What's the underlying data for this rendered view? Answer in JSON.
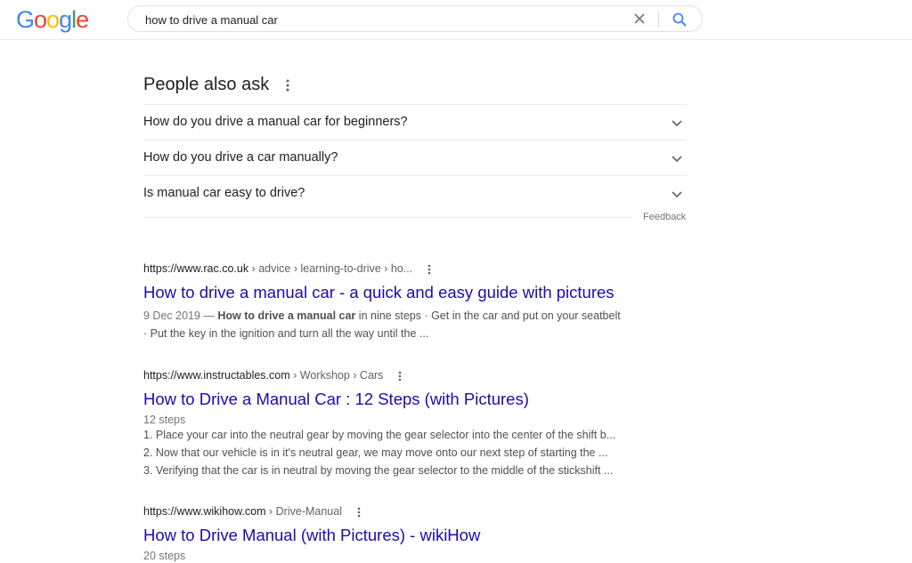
{
  "logo": {
    "letters": [
      "G",
      "o",
      "o",
      "g",
      "l",
      "e"
    ],
    "colors": [
      "#4285F4",
      "#EA4335",
      "#FBBC05",
      "#4285F4",
      "#34A853",
      "#EA4335"
    ]
  },
  "search": {
    "query": "how to drive a manual car"
  },
  "paa": {
    "title": "People also ask",
    "questions": [
      "How do you drive a manual car for beginners?",
      "How do you drive a car manually?",
      "Is manual car easy to drive?"
    ],
    "feedback": "Feedback"
  },
  "results": [
    {
      "domain": "https://www.rac.co.uk",
      "path": " › advice › learning-to-drive › ho...",
      "title": "How to drive a manual car - a quick and easy guide with pictures",
      "date": "9 Dec 2019 — ",
      "snippet_bold": "How to drive a manual car",
      "snippet_rest": " in nine steps · Get in the car and put on your seatbelt",
      "snippet_line2": "· Put the key in the ignition and turn all the way until the ..."
    },
    {
      "domain": "https://www.instructables.com",
      "path": " › Workshop › Cars",
      "title": "How to Drive a Manual Car : 12 Steps (with Pictures)",
      "steps_label": "12 steps",
      "steps": [
        "1.  Place your car into the neutral gear by moving the gear selector into the center of the shift b...",
        "2.  Now that our vehicle is in it's neutral gear, we may move onto our next step of starting the ...",
        "3.  Verifying that the car is in neutral by moving the gear selector to the middle of the stickshift ..."
      ]
    },
    {
      "domain": "https://www.wikihow.com",
      "path": " › Drive-Manual",
      "title": "How to Drive Manual (with Pictures) - wikiHow",
      "steps_label": "20 steps"
    }
  ],
  "colors": {
    "link": "#1a0dab",
    "search_icon": "#4285F4"
  }
}
